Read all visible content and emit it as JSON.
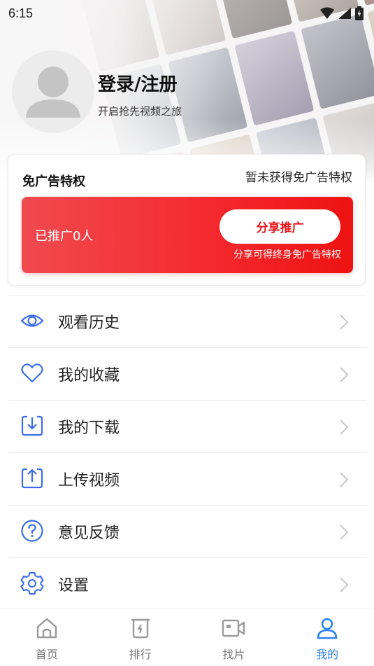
{
  "status_bar": {
    "time": "6:15"
  },
  "profile": {
    "login_title": "登录/注册",
    "subtitle": "开启抢先视频之旅"
  },
  "privilege": {
    "title": "免广告特权",
    "status": "暂未获得免广告特权",
    "promo_count": "已推广0人",
    "share_button": "分享推广",
    "share_hint": "分享可得终身免广告特权"
  },
  "menu": {
    "items": [
      {
        "label": "观看历史",
        "icon": "eye-icon"
      },
      {
        "label": "我的收藏",
        "icon": "heart-icon"
      },
      {
        "label": "我的下载",
        "icon": "download-icon"
      },
      {
        "label": "上传视频",
        "icon": "upload-icon"
      },
      {
        "label": "意见反馈",
        "icon": "question-icon"
      },
      {
        "label": "设置",
        "icon": "gear-icon"
      }
    ]
  },
  "bottom_nav": {
    "items": [
      {
        "label": "首页",
        "icon": "home-icon",
        "active": false
      },
      {
        "label": "排行",
        "icon": "ranking-icon",
        "active": false
      },
      {
        "label": "找片",
        "icon": "video-camera-icon",
        "active": false
      },
      {
        "label": "我的",
        "icon": "user-icon",
        "active": true
      }
    ]
  },
  "colors": {
    "accent_blue": "#2a83ef",
    "icon_blue": "#3b6ee8",
    "promo_red": "#f42a2f",
    "share_text_red": "#e8161b",
    "nav_inactive": "#777777"
  }
}
